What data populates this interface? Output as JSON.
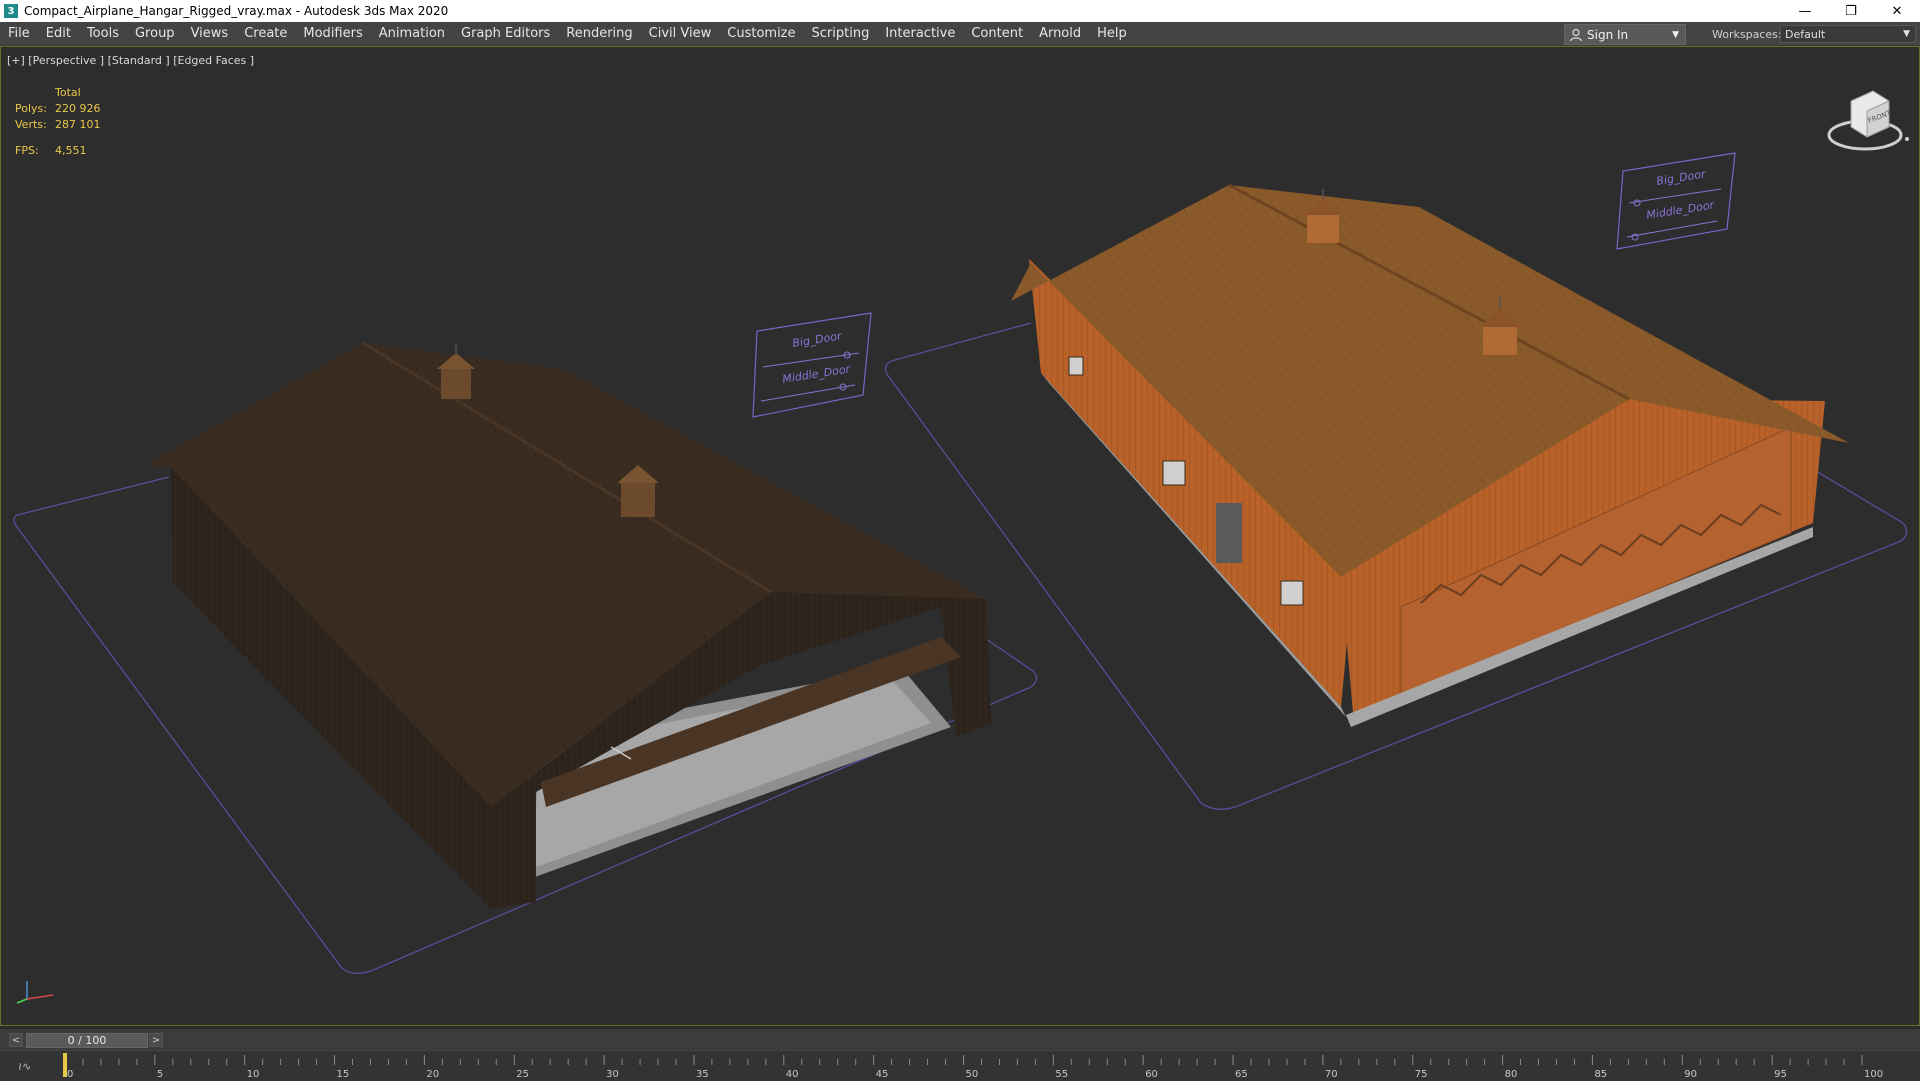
{
  "window": {
    "title": "Compact_Airplane_Hangar_Rigged_vray.max - Autodesk 3ds Max 2020",
    "app_icon": "3",
    "minimize": "—",
    "restore": "❐",
    "close": "✕"
  },
  "menu": {
    "items": [
      "File",
      "Edit",
      "Tools",
      "Group",
      "Views",
      "Create",
      "Modifiers",
      "Animation",
      "Graph Editors",
      "Rendering",
      "Civil View",
      "Customize",
      "Scripting",
      "Interactive",
      "Content",
      "Arnold",
      "Help"
    ],
    "sign_in": "Sign In",
    "workspaces_label": "Workspaces:",
    "workspace_value": "Default"
  },
  "viewport": {
    "label": "[+] [Perspective ] [Standard ] [Edged Faces ]",
    "stats": {
      "total_label": "Total",
      "polys_label": "Polys:",
      "polys_value": "220 926",
      "verts_label": "Verts:",
      "verts_value": "287 101",
      "fps_label": "FPS:",
      "fps_value": "4,551"
    },
    "controls_left": {
      "big_door": "Big_Door",
      "middle_door": "Middle_Door"
    },
    "controls_right": {
      "big_door": "Big_Door",
      "middle_door": "Middle_Door"
    },
    "viewcube_face": "FRONT"
  },
  "timeline": {
    "frame_display": "0 / 100",
    "prev": "<",
    "next": ">",
    "ticks": [
      "0",
      "5",
      "10",
      "15",
      "20",
      "25",
      "30",
      "35",
      "40",
      "45",
      "50",
      "55",
      "60",
      "65",
      "70",
      "75",
      "80",
      "85",
      "90",
      "95",
      "100"
    ]
  },
  "colors": {
    "viewport_bg": "#2d2d2d",
    "stats_yellow": "#e8c84a",
    "control_purple": "#8a63d2",
    "roof_dark": "#3a2c20",
    "roof_orange": "#8a5a2a",
    "wall_orange": "#b8622a"
  }
}
